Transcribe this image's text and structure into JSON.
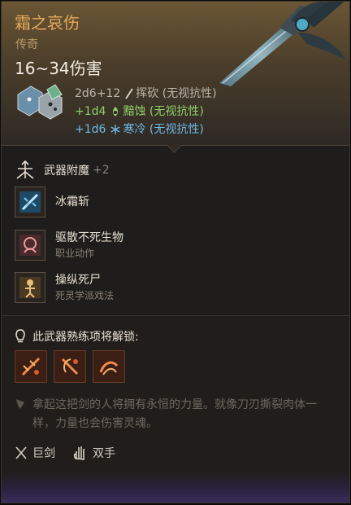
{
  "item": {
    "name": "霜之哀伤",
    "rarity": "传奇",
    "damage_total": "16~34伤害"
  },
  "damage_rows": [
    {
      "dice": "2d6+12",
      "type": "挥砍",
      "note": "(无视抗性)",
      "icon": "slash-icon",
      "color": "#bdb5aa"
    },
    {
      "dice": "+1d4",
      "type": "黯蚀",
      "note": "(无视抗性)",
      "icon": "necrotic-icon",
      "color": "#8fd16a"
    },
    {
      "dice": "+1d6",
      "type": "寒冷",
      "note": "(无视抗性)",
      "icon": "snowflake-icon",
      "color": "#6db8e6"
    }
  ],
  "enchant": {
    "label": "武器附魔",
    "count": "+2",
    "icon": "weapon-enchant-icon"
  },
  "abilities": [
    {
      "title": "冰霜斩",
      "subtitle": "",
      "icon": "frost-slash-icon"
    },
    {
      "title": "驱散不死生物",
      "subtitle": "职业动作",
      "icon": "turn-undead-icon"
    },
    {
      "title": "操纵死尸",
      "subtitle": "死灵学派戏法",
      "icon": "animate-dead-icon"
    }
  ],
  "unlock": {
    "label": "此武器熟练项将解锁:",
    "icon": "unlock-icon",
    "proficiency_icons": [
      "lacerate-icon",
      "pommel-strike-icon",
      "cleave-icon"
    ]
  },
  "flavor_text": "拿起这把剑的人将拥有永恒的力量。就像刀刃撕裂肉体一样，力量也会伤害灵魂。",
  "footer": {
    "weapon_type": "巨剑",
    "handedness": "双手",
    "weapon_type_icon": "greatsword-icon",
    "handedness_icon": "two-handed-icon"
  },
  "colors": {
    "name": "#e7a95a",
    "rarity": "#b89a6a",
    "green": "#8fd16a",
    "blue": "#6db8e6"
  }
}
